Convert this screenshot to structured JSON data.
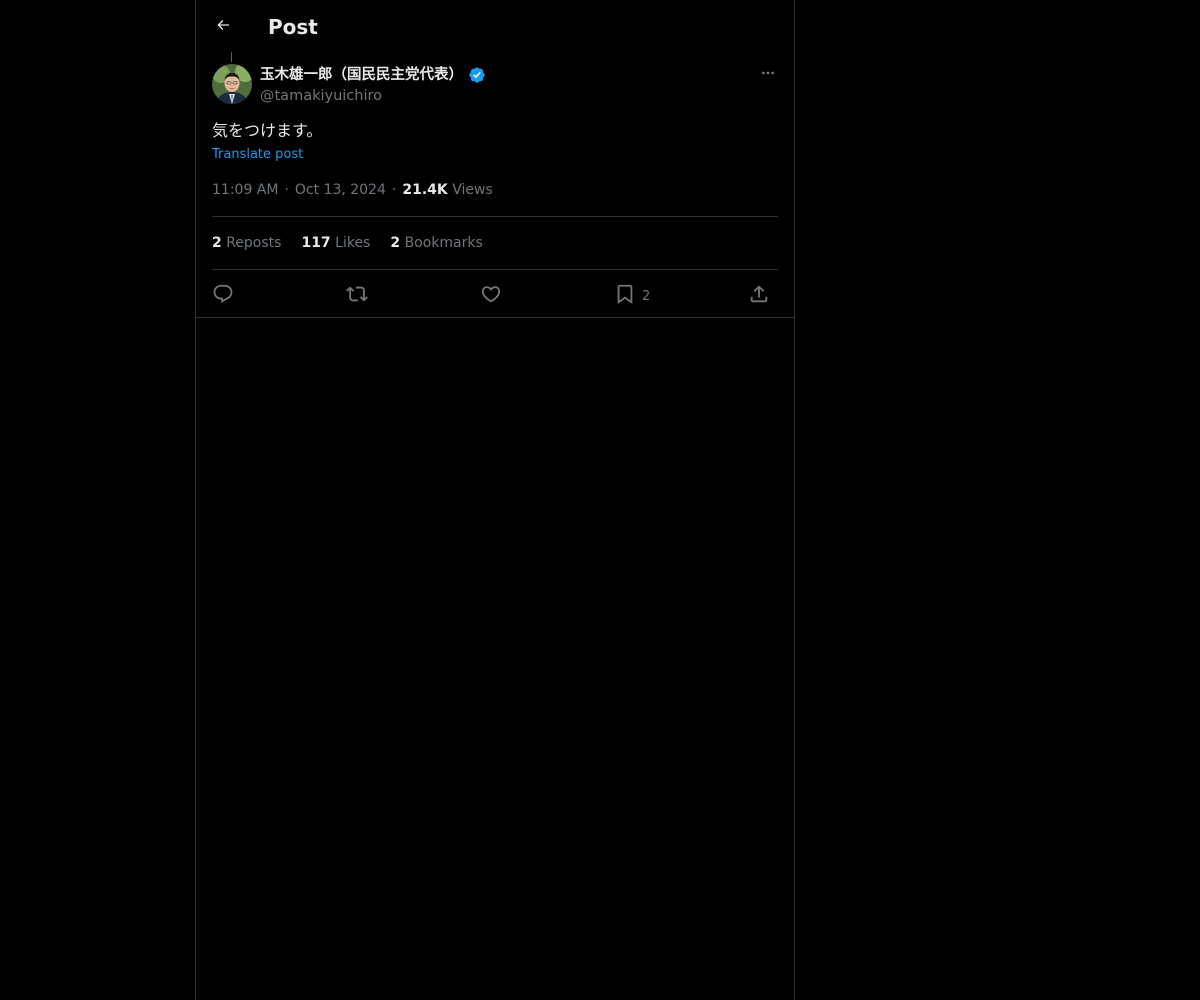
{
  "header": {
    "title": "Post",
    "back_icon": "arrow-left-icon"
  },
  "author": {
    "name": "玉木雄一郎（国民民主党代表）",
    "handle": "@tamakiyuichiro",
    "verified": true,
    "verified_color": "#1d9bf0"
  },
  "post": {
    "text": "気をつけます。",
    "translate_label": "Translate post",
    "time": "11:09 AM",
    "date": "Oct 13, 2024",
    "views_count": "21.4K",
    "views_label": "Views",
    "separator": "·"
  },
  "stats": {
    "reposts_count": "2",
    "reposts_label": "Reposts",
    "likes_count": "117",
    "likes_label": "Likes",
    "bookmarks_count": "2",
    "bookmarks_label": "Bookmarks"
  },
  "actions": {
    "reply_icon": "reply-icon",
    "repost_icon": "repost-icon",
    "like_icon": "heart-icon",
    "bookmark_icon": "bookmark-icon",
    "bookmark_count": "2",
    "share_icon": "share-icon"
  },
  "colors": {
    "background": "#000000",
    "text_primary": "#e7e9ea",
    "text_secondary": "#71767b",
    "link": "#1d9bf0",
    "border": "#2f3336"
  }
}
